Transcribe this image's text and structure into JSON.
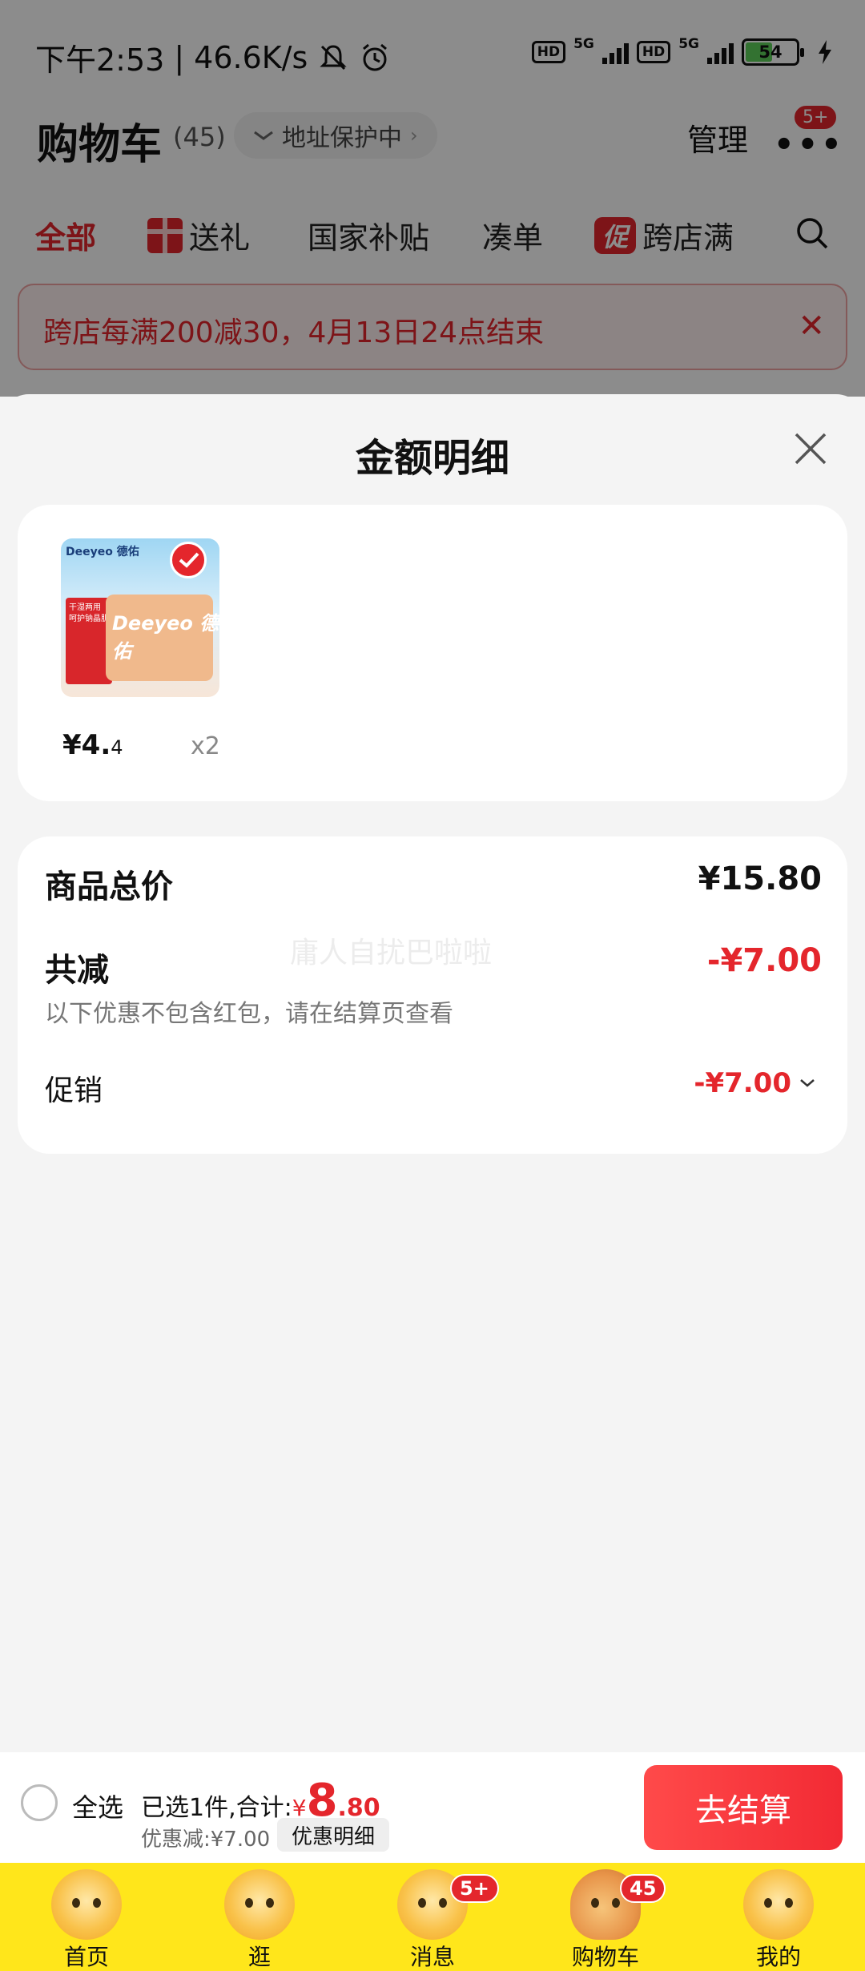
{
  "status_bar": {
    "time": "下午2:53",
    "speed": "46.6K/s",
    "hd1": "HD",
    "net1": "5G",
    "hd2": "HD",
    "net2": "5G",
    "battery": "54",
    "icons": [
      "mute-icon",
      "alarm-icon",
      "signal-icon",
      "battery-icon",
      "charging-icon"
    ]
  },
  "header": {
    "title": "购物车",
    "count": "(45)",
    "address": "地址保护中",
    "manage": "管理",
    "more_badge": "5+"
  },
  "tabs": [
    {
      "label": "全部"
    },
    {
      "label": "送礼"
    },
    {
      "label": "国家补贴"
    },
    {
      "label": "凑单"
    },
    {
      "tag": "促",
      "label": "跨店满"
    }
  ],
  "banner": {
    "text": "跨店每满200减30，4月13日24点结束"
  },
  "sheet": {
    "title": "金额明细",
    "product": {
      "brand": "Deeyeo 德佑",
      "thumb_tag": "干湿两用 呵护钠晶肌",
      "pack_text": "Deeyeo 德佑",
      "price_main": "¥4.",
      "price_sub": "4",
      "qty": "x2"
    },
    "summary": {
      "total_label": "商品总价",
      "total_value": "¥15.80",
      "discount_label": "共减",
      "discount_value": "-¥7.00",
      "discount_note": "以下优惠不包含红包，请在结算页查看",
      "promo_label": "促销",
      "promo_value": "-¥7.00",
      "watermark": "庸人自扰巴啦啦"
    }
  },
  "checkout": {
    "select_all": "全选",
    "selected_text": "已选1件,合计:",
    "currency": "¥",
    "amount_int": "8",
    "amount_dec": ".80",
    "discount_text": "优惠减:¥7.00",
    "detail_button": "优惠明细",
    "pay_button": "去结算"
  },
  "bottom_nav": [
    {
      "label": "首页",
      "icon": "home-mascot-icon"
    },
    {
      "label": "逛",
      "icon": "browse-mascot-icon"
    },
    {
      "label": "消息",
      "icon": "message-mascot-icon",
      "badge": "5+"
    },
    {
      "label": "购物车",
      "icon": "cart-icon",
      "badge": "45"
    },
    {
      "label": "我的",
      "icon": "profile-mascot-icon"
    }
  ],
  "colors": {
    "accent": "#e4262c",
    "nav_bg": "#ffe61b",
    "sheet_bg": "#f4f4f4"
  }
}
